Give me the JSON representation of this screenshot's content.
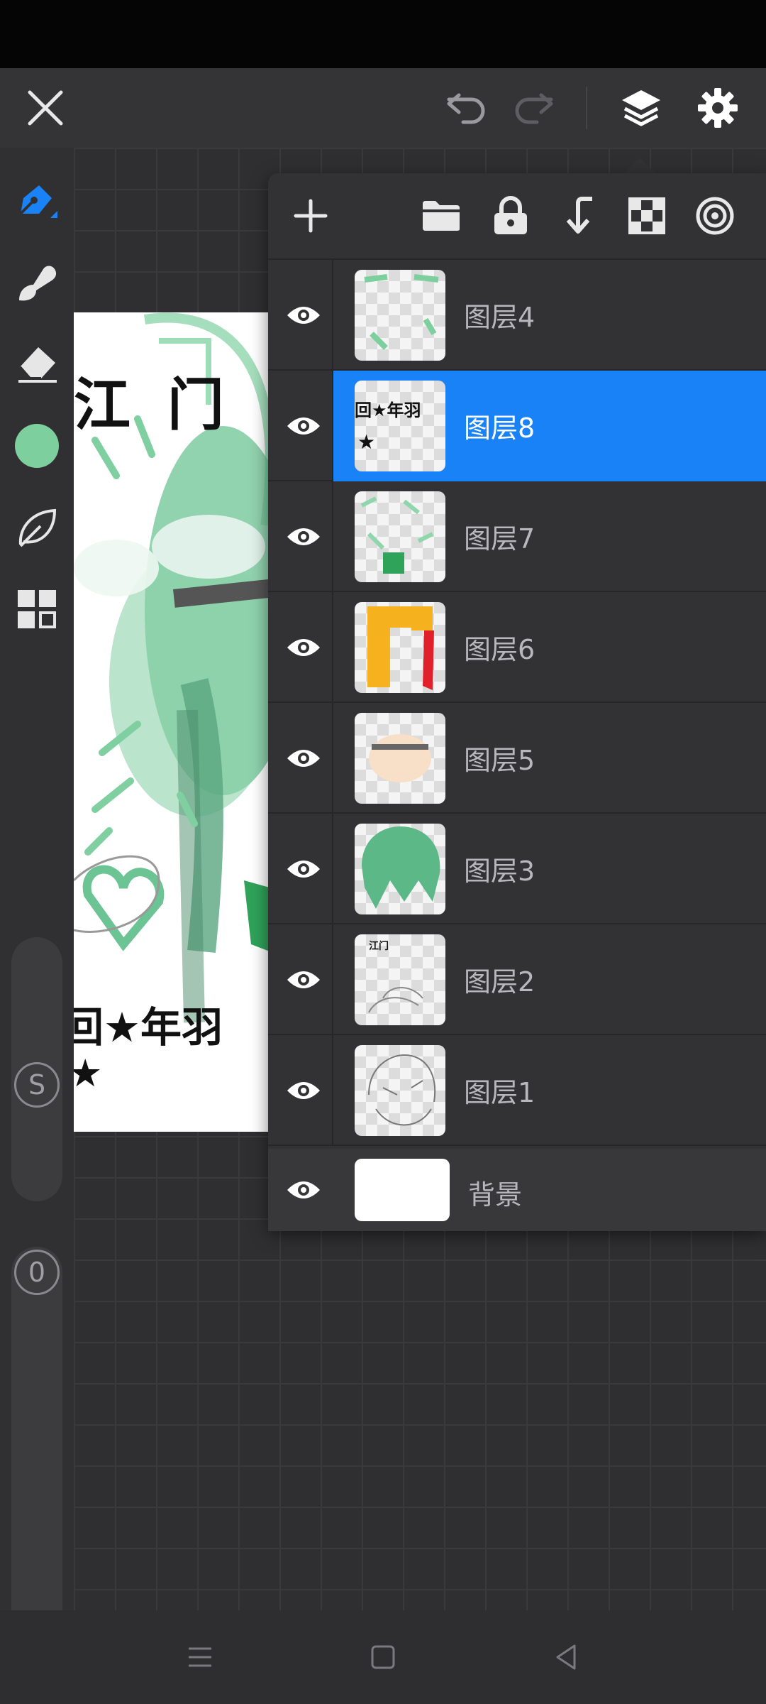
{
  "app": {
    "accent": "#1a82f7",
    "brush_color": "#7dcf9e"
  },
  "top_bar": {
    "icons": [
      "close-icon",
      "undo-icon",
      "redo-icon",
      "layers-icon",
      "settings-icon"
    ]
  },
  "left_toolbar": {
    "tools": [
      "pen-icon",
      "smudge-icon",
      "eraser-icon",
      "color-swatch",
      "leaf-icon",
      "grid-icon"
    ],
    "size_badge": "S",
    "opacity_badge": "0"
  },
  "artwork": {
    "title_text": "江 门",
    "signature_text": "回★年羽",
    "star_text": "★"
  },
  "layer_panel": {
    "header_icons": [
      "add-icon",
      "folder-icon",
      "lock-icon",
      "merge-down-icon",
      "checker-icon",
      "spiral-icon"
    ],
    "layers": [
      {
        "name": "图层4",
        "selected": false
      },
      {
        "name": "图层8",
        "selected": true,
        "thumb_text": "回★年羽",
        "thumb_star": "★"
      },
      {
        "name": "图层7",
        "selected": false
      },
      {
        "name": "图层6",
        "selected": false
      },
      {
        "name": "图层5",
        "selected": false
      },
      {
        "name": "图层3",
        "selected": false
      },
      {
        "name": "图层2",
        "selected": false,
        "thumb_text": "江门"
      },
      {
        "name": "图层1",
        "selected": false
      }
    ],
    "background": {
      "name": "背景"
    }
  },
  "nav_bar": {
    "icons": [
      "menu-icon",
      "home-icon",
      "back-icon"
    ]
  }
}
